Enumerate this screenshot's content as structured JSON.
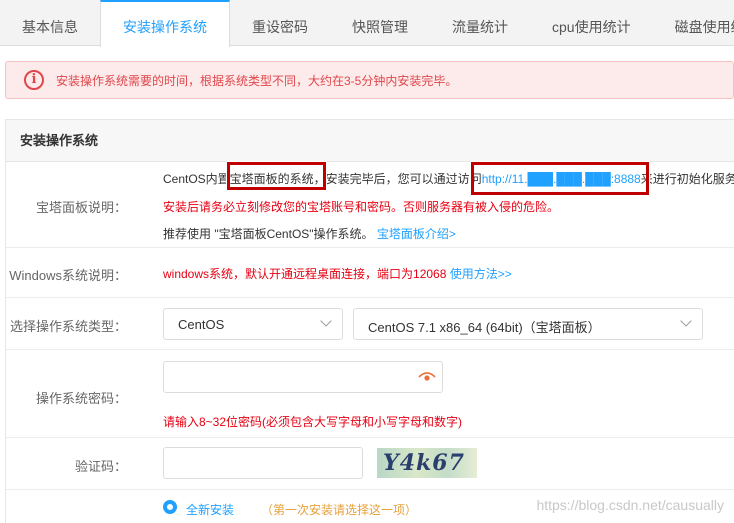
{
  "tabs": [
    {
      "label": "基本信息",
      "active": false
    },
    {
      "label": "安装操作系统",
      "active": true
    },
    {
      "label": "重设密码",
      "active": false
    },
    {
      "label": "快照管理",
      "active": false
    },
    {
      "label": "流量统计",
      "active": false
    },
    {
      "label": "cpu使用统计",
      "active": false
    },
    {
      "label": "磁盘使用统计",
      "active": false
    }
  ],
  "alert": {
    "icon": "info-icon",
    "icon_glyph": "i",
    "message": "安装操作系统需要的时间，根据系统类型不同，大约在3-5分钟内安装完毕。"
  },
  "section": {
    "title": "安装操作系统",
    "panel": {
      "label": "宝塔面板说明：",
      "line1_a": "CentOS内置宝塔面板的系统，安装完毕后，您可以通过访问",
      "line1_url": "http://11.███.███.███:8888",
      "line1_b": "来进行初始化服务器",
      "line2": "安装后请务必立刻修改您的宝塔账号和密码。否则服务器有被入侵的危险。",
      "line3": "推荐使用 \"宝塔面板CentOS\"操作系统。",
      "line3_link": "宝塔面板介绍>"
    },
    "windows": {
      "label": "Windows系统说明：",
      "text": "windows系统，默认开通远程桌面连接，端口为12068",
      "link": "使用方法>>"
    },
    "os_type": {
      "label": "选择操作系统类型：",
      "family": "CentOS",
      "version": "CentOS 7.1 x86_64 (64bit)（宝塔面板）"
    },
    "password": {
      "label": "操作系统密码：",
      "value": "",
      "hint": "请输入8~32位密码(必须包含大写字母和小写字母和数字)"
    },
    "captcha": {
      "label": "验证码：",
      "value": "",
      "image_text": "Y4k67"
    },
    "install": {
      "option": "全新安装",
      "note": "（第一次安装请选择这一项）"
    }
  },
  "watermark": "https://blog.csdn.net/causually",
  "colors": {
    "accent": "#20a0ff",
    "error": "#e60012",
    "alert_bg": "#fdeaea",
    "highlight": "#c00000"
  }
}
